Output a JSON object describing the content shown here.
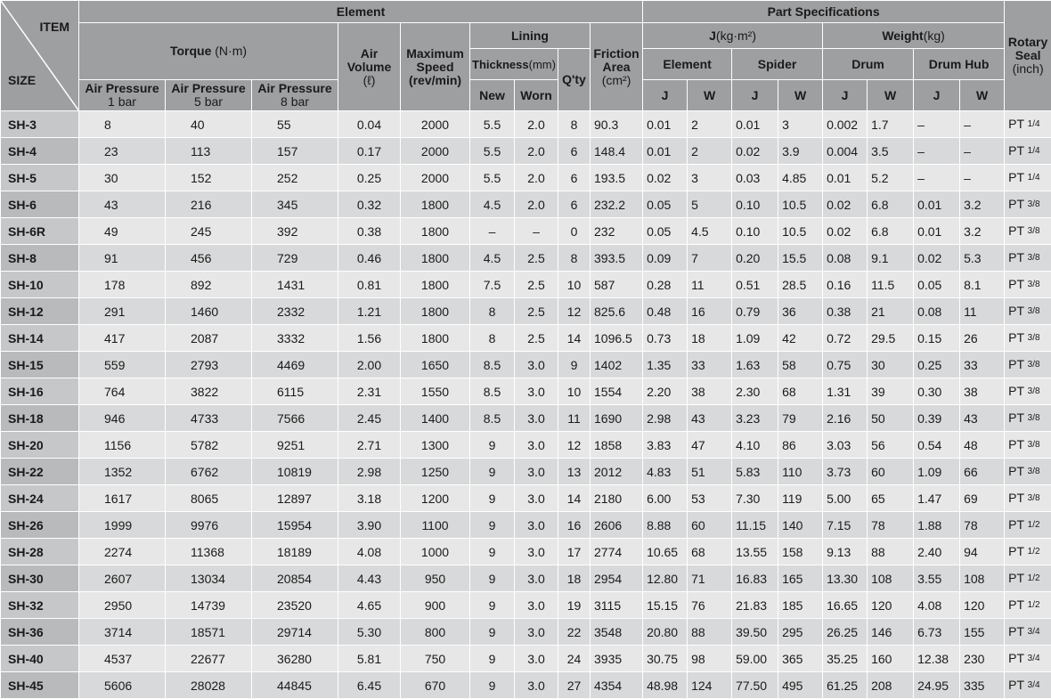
{
  "header": {
    "item": "ITEM",
    "size": "SIZE",
    "element": "Element",
    "part_specs": "Part Specifications",
    "torque": "Torque",
    "torque_unit": "(N·m)",
    "air_pressure_label": "Air Pressure",
    "ap1": "1 bar",
    "ap5": "5 bar",
    "ap8": "8 bar",
    "air_volume_1": "Air",
    "air_volume_2": "Volume",
    "air_volume_unit": "(ℓ)",
    "max_speed_1": "Maximum",
    "max_speed_2": "Speed",
    "max_speed_unit": "(rev/min)",
    "lining": "Lining",
    "thickness": "Thickness",
    "thickness_unit": "(mm)",
    "new": "New",
    "worn": "Worn",
    "qty": "Q'ty",
    "friction_1": "Friction",
    "friction_2": "Area",
    "friction_unit": "(cm²)",
    "j_label": "J",
    "j_unit": "(kg·m²)",
    "weight_label": "Weight",
    "weight_unit": "(kg)",
    "el_element": "Element",
    "el_spider": "Spider",
    "el_drum": "Drum",
    "el_drumhub": "Drum Hub",
    "j": "J",
    "w": "W",
    "rotary_1": "Rotary",
    "rotary_2": "Seal",
    "rotary_unit": "(inch)"
  },
  "rows": [
    {
      "size": "SH-3",
      "t1": "8",
      "t5": "40",
      "t8": "55",
      "vol": "0.04",
      "speed": "2000",
      "new": "5.5",
      "worn": "2.0",
      "qty": "8",
      "area": "90.3",
      "ej": "0.01",
      "ew": "2",
      "sj": "0.01",
      "sw": "3",
      "dj": "0.002",
      "dw": "1.7",
      "hj": "–",
      "hw": "–",
      "seal": "PT",
      "seal_frac": "1/4"
    },
    {
      "size": "SH-4",
      "t1": "23",
      "t5": "113",
      "t8": "157",
      "vol": "0.17",
      "speed": "2000",
      "new": "5.5",
      "worn": "2.0",
      "qty": "6",
      "area": "148.4",
      "ej": "0.01",
      "ew": "2",
      "sj": "0.02",
      "sw": "3.9",
      "dj": "0.004",
      "dw": "3.5",
      "hj": "–",
      "hw": "–",
      "seal": "PT",
      "seal_frac": "1/4"
    },
    {
      "size": "SH-5",
      "t1": "30",
      "t5": "152",
      "t8": "252",
      "vol": "0.25",
      "speed": "2000",
      "new": "5.5",
      "worn": "2.0",
      "qty": "6",
      "area": "193.5",
      "ej": "0.02",
      "ew": "3",
      "sj": "0.03",
      "sw": "4.85",
      "dj": "0.01",
      "dw": "5.2",
      "hj": "–",
      "hw": "–",
      "seal": "PT",
      "seal_frac": "1/4"
    },
    {
      "size": "SH-6",
      "t1": "43",
      "t5": "216",
      "t8": "345",
      "vol": "0.32",
      "speed": "1800",
      "new": "4.5",
      "worn": "2.0",
      "qty": "6",
      "area": "232.2",
      "ej": "0.05",
      "ew": "5",
      "sj": "0.10",
      "sw": "10.5",
      "dj": "0.02",
      "dw": "6.8",
      "hj": "0.01",
      "hw": "3.2",
      "seal": "PT",
      "seal_frac": "3/8"
    },
    {
      "size": "SH-6R",
      "t1": "49",
      "t5": "245",
      "t8": "392",
      "vol": "0.38",
      "speed": "1800",
      "new": "–",
      "worn": "–",
      "qty": "0",
      "area": "232",
      "ej": "0.05",
      "ew": "4.5",
      "sj": "0.10",
      "sw": "10.5",
      "dj": "0.02",
      "dw": "6.8",
      "hj": "0.01",
      "hw": "3.2",
      "seal": "PT",
      "seal_frac": "3/8"
    },
    {
      "size": "SH-8",
      "t1": "91",
      "t5": "456",
      "t8": "729",
      "vol": "0.46",
      "speed": "1800",
      "new": "4.5",
      "worn": "2.5",
      "qty": "8",
      "area": "393.5",
      "ej": "0.09",
      "ew": "7",
      "sj": "0.20",
      "sw": "15.5",
      "dj": "0.08",
      "dw": "9.1",
      "hj": "0.02",
      "hw": "5.3",
      "seal": "PT",
      "seal_frac": "3/8",
      "grp": true
    },
    {
      "size": "SH-10",
      "t1": "178",
      "t5": "892",
      "t8": "1431",
      "vol": "0.81",
      "speed": "1800",
      "new": "7.5",
      "worn": "2.5",
      "qty": "10",
      "area": "587",
      "ej": "0.28",
      "ew": "11",
      "sj": "0.51",
      "sw": "28.5",
      "dj": "0.16",
      "dw": "11.5",
      "hj": "0.05",
      "hw": "8.1",
      "seal": "PT",
      "seal_frac": "3/8"
    },
    {
      "size": "SH-12",
      "t1": "291",
      "t5": "1460",
      "t8": "2332",
      "vol": "1.21",
      "speed": "1800",
      "new": "8",
      "worn": "2.5",
      "qty": "12",
      "area": "825.6",
      "ej": "0.48",
      "ew": "16",
      "sj": "0.79",
      "sw": "36",
      "dj": "0.38",
      "dw": "21",
      "hj": "0.08",
      "hw": "11",
      "seal": "PT",
      "seal_frac": "3/8"
    },
    {
      "size": "SH-14",
      "t1": "417",
      "t5": "2087",
      "t8": "3332",
      "vol": "1.56",
      "speed": "1800",
      "new": "8",
      "worn": "2.5",
      "qty": "14",
      "area": "1096.5",
      "ej": "0.73",
      "ew": "18",
      "sj": "1.09",
      "sw": "42",
      "dj": "0.72",
      "dw": "29.5",
      "hj": "0.15",
      "hw": "26",
      "seal": "PT",
      "seal_frac": "3/8"
    },
    {
      "size": "SH-15",
      "t1": "559",
      "t5": "2793",
      "t8": "4469",
      "vol": "2.00",
      "speed": "1650",
      "new": "8.5",
      "worn": "3.0",
      "qty": "9",
      "area": "1402",
      "ej": "1.35",
      "ew": "33",
      "sj": "1.63",
      "sw": "58",
      "dj": "0.75",
      "dw": "30",
      "hj": "0.25",
      "hw": "33",
      "seal": "PT",
      "seal_frac": "3/8"
    },
    {
      "size": "SH-16",
      "t1": "764",
      "t5": "3822",
      "t8": "6115",
      "vol": "2.31",
      "speed": "1550",
      "new": "8.5",
      "worn": "3.0",
      "qty": "10",
      "area": "1554",
      "ej": "2.20",
      "ew": "38",
      "sj": "2.30",
      "sw": "68",
      "dj": "1.31",
      "dw": "39",
      "hj": "0.30",
      "hw": "38",
      "seal": "PT",
      "seal_frac": "3/8",
      "grp": true
    },
    {
      "size": "SH-18",
      "t1": "946",
      "t5": "4733",
      "t8": "7566",
      "vol": "2.45",
      "speed": "1400",
      "new": "8.5",
      "worn": "3.0",
      "qty": "11",
      "area": "1690",
      "ej": "2.98",
      "ew": "43",
      "sj": "3.23",
      "sw": "79",
      "dj": "2.16",
      "dw": "50",
      "hj": "0.39",
      "hw": "43",
      "seal": "PT",
      "seal_frac": "3/8"
    },
    {
      "size": "SH-20",
      "t1": "1156",
      "t5": "5782",
      "t8": "9251",
      "vol": "2.71",
      "speed": "1300",
      "new": "9",
      "worn": "3.0",
      "qty": "12",
      "area": "1858",
      "ej": "3.83",
      "ew": "47",
      "sj": "4.10",
      "sw": "86",
      "dj": "3.03",
      "dw": "56",
      "hj": "0.54",
      "hw": "48",
      "seal": "PT",
      "seal_frac": "3/8"
    },
    {
      "size": "SH-22",
      "t1": "1352",
      "t5": "6762",
      "t8": "10819",
      "vol": "2.98",
      "speed": "1250",
      "new": "9",
      "worn": "3.0",
      "qty": "13",
      "area": "2012",
      "ej": "4.83",
      "ew": "51",
      "sj": "5.83",
      "sw": "110",
      "dj": "3.73",
      "dw": "60",
      "hj": "1.09",
      "hw": "66",
      "seal": "PT",
      "seal_frac": "3/8"
    },
    {
      "size": "SH-24",
      "t1": "1617",
      "t5": "8065",
      "t8": "12897",
      "vol": "3.18",
      "speed": "1200",
      "new": "9",
      "worn": "3.0",
      "qty": "14",
      "area": "2180",
      "ej": "6.00",
      "ew": "53",
      "sj": "7.30",
      "sw": "119",
      "dj": "5.00",
      "dw": "65",
      "hj": "1.47",
      "hw": "69",
      "seal": "PT",
      "seal_frac": "3/8"
    },
    {
      "size": "SH-26",
      "t1": "1999",
      "t5": "9976",
      "t8": "15954",
      "vol": "3.90",
      "speed": "1100",
      "new": "9",
      "worn": "3.0",
      "qty": "16",
      "area": "2606",
      "ej": "8.88",
      "ew": "60",
      "sj": "11.15",
      "sw": "140",
      "dj": "7.15",
      "dw": "78",
      "hj": "1.88",
      "hw": "78",
      "seal": "PT",
      "seal_frac": "1/2"
    },
    {
      "size": "SH-28",
      "t1": "2274",
      "t5": "11368",
      "t8": "18189",
      "vol": "4.08",
      "speed": "1000",
      "new": "9",
      "worn": "3.0",
      "qty": "17",
      "area": "2774",
      "ej": "10.65",
      "ew": "68",
      "sj": "13.55",
      "sw": "158",
      "dj": "9.13",
      "dw": "88",
      "hj": "2.40",
      "hw": "94",
      "seal": "PT",
      "seal_frac": "1/2",
      "grp": true
    },
    {
      "size": "SH-30",
      "t1": "2607",
      "t5": "13034",
      "t8": "20854",
      "vol": "4.43",
      "speed": "950",
      "new": "9",
      "worn": "3.0",
      "qty": "18",
      "area": "2954",
      "ej": "12.80",
      "ew": "71",
      "sj": "16.83",
      "sw": "165",
      "dj": "13.30",
      "dw": "108",
      "hj": "3.55",
      "hw": "108",
      "seal": "PT",
      "seal_frac": "1/2"
    },
    {
      "size": "SH-32",
      "t1": "2950",
      "t5": "14739",
      "t8": "23520",
      "vol": "4.65",
      "speed": "900",
      "new": "9",
      "worn": "3.0",
      "qty": "19",
      "area": "3115",
      "ej": "15.15",
      "ew": "76",
      "sj": "21.83",
      "sw": "185",
      "dj": "16.65",
      "dw": "120",
      "hj": "4.08",
      "hw": "120",
      "seal": "PT",
      "seal_frac": "1/2"
    },
    {
      "size": "SH-36",
      "t1": "3714",
      "t5": "18571",
      "t8": "29714",
      "vol": "5.30",
      "speed": "800",
      "new": "9",
      "worn": "3.0",
      "qty": "22",
      "area": "3548",
      "ej": "20.80",
      "ew": "88",
      "sj": "39.50",
      "sw": "295",
      "dj": "26.25",
      "dw": "146",
      "hj": "6.73",
      "hw": "155",
      "seal": "PT",
      "seal_frac": "3/4"
    },
    {
      "size": "SH-40",
      "t1": "4537",
      "t5": "22677",
      "t8": "36280",
      "vol": "5.81",
      "speed": "750",
      "new": "9",
      "worn": "3.0",
      "qty": "24",
      "area": "3935",
      "ej": "30.75",
      "ew": "98",
      "sj": "59.00",
      "sw": "365",
      "dj": "35.25",
      "dw": "160",
      "hj": "12.38",
      "hw": "230",
      "seal": "PT",
      "seal_frac": "3/4"
    },
    {
      "size": "SH-45",
      "t1": "5606",
      "t5": "28028",
      "t8": "44845",
      "vol": "6.45",
      "speed": "670",
      "new": "9",
      "worn": "3.0",
      "qty": "27",
      "area": "4354",
      "ej": "48.98",
      "ew": "124",
      "sj": "77.50",
      "sw": "495",
      "dj": "61.25",
      "dw": "208",
      "hj": "24.95",
      "hw": "335",
      "seal": "PT",
      "seal_frac": "3/4"
    }
  ]
}
